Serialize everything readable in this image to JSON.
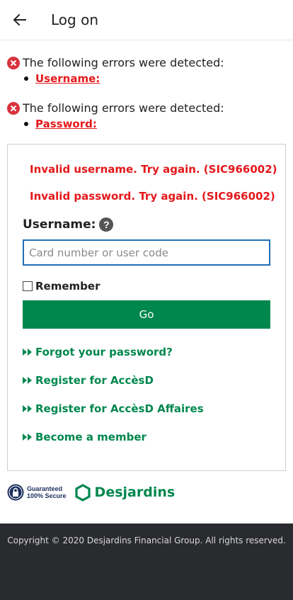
{
  "header": {
    "title": "Log on",
    "back_icon": "arrow-left-icon"
  },
  "errors": [
    {
      "message": "The following errors were detected:",
      "item": "Username:"
    },
    {
      "message": "The following errors were detected:",
      "item": "Password:"
    }
  ],
  "form": {
    "invalid_username": "Invalid username. Try again. (SIC966002)",
    "invalid_password": "Invalid password. Try again. (SIC966002)",
    "username_label": "Username:",
    "help_glyph": "?",
    "username_placeholder": "Card number or user code",
    "username_value": "",
    "remember_label": "Remember",
    "remember_checked": false,
    "go_label": "Go"
  },
  "links": [
    "Forgot your password?",
    "Register for AccèsD",
    "Register for AccèsD Affaires",
    "Become a member"
  ],
  "badges": {
    "secure_line1": "Guaranteed",
    "secure_line2": "100% Secure",
    "brand": "Desjardins"
  },
  "footer": {
    "copyright": "Copyright © 2020 Desjardins Financial Group. All rights reserved."
  },
  "colors": {
    "error": "#e4181b",
    "brand_green": "#00874e",
    "input_border": "#1f6fb5",
    "footer_bg": "#2a2b2e"
  }
}
